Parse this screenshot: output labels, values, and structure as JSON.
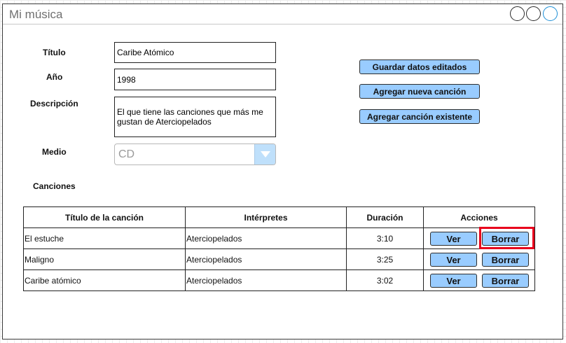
{
  "window": {
    "title": "Mi música",
    "controls": [
      "window-button",
      "window-button",
      "window-button"
    ]
  },
  "form": {
    "titulo_label": "Título",
    "titulo_value": "Caribe Atómico",
    "anio_label": "Año",
    "anio_value": "1998",
    "descripcion_label": "Descripción",
    "descripcion_value": "El que tiene las canciones que más me gustan de Aterciopelados",
    "medio_label": "Medio",
    "medio_value": "CD",
    "canciones_label": "Canciones"
  },
  "actions": {
    "guardar": "Guardar datos editados",
    "agregar_nueva": "Agregar nueva canción",
    "agregar_existente": "Agregar canción existente"
  },
  "table": {
    "headers": [
      "Título de la canción",
      "Intérpretes",
      "Duración",
      "Acciones"
    ],
    "rows": [
      {
        "titulo": "El estuche",
        "interpretes": "Aterciopelados",
        "duracion": "3:10",
        "ver": "Ver",
        "borrar": "Borrar"
      },
      {
        "titulo": "Maligno",
        "interpretes": "Aterciopelados",
        "duracion": "3:25",
        "ver": "Ver",
        "borrar": "Borrar"
      },
      {
        "titulo": "Caribe atómico",
        "interpretes": "Aterciopelados",
        "duracion": "3:02",
        "ver": "Ver",
        "borrar": "Borrar"
      }
    ]
  },
  "colors": {
    "button_fill": "#99ccff",
    "select_arrow": "#bfe0fb",
    "highlight": "#e8001c"
  }
}
